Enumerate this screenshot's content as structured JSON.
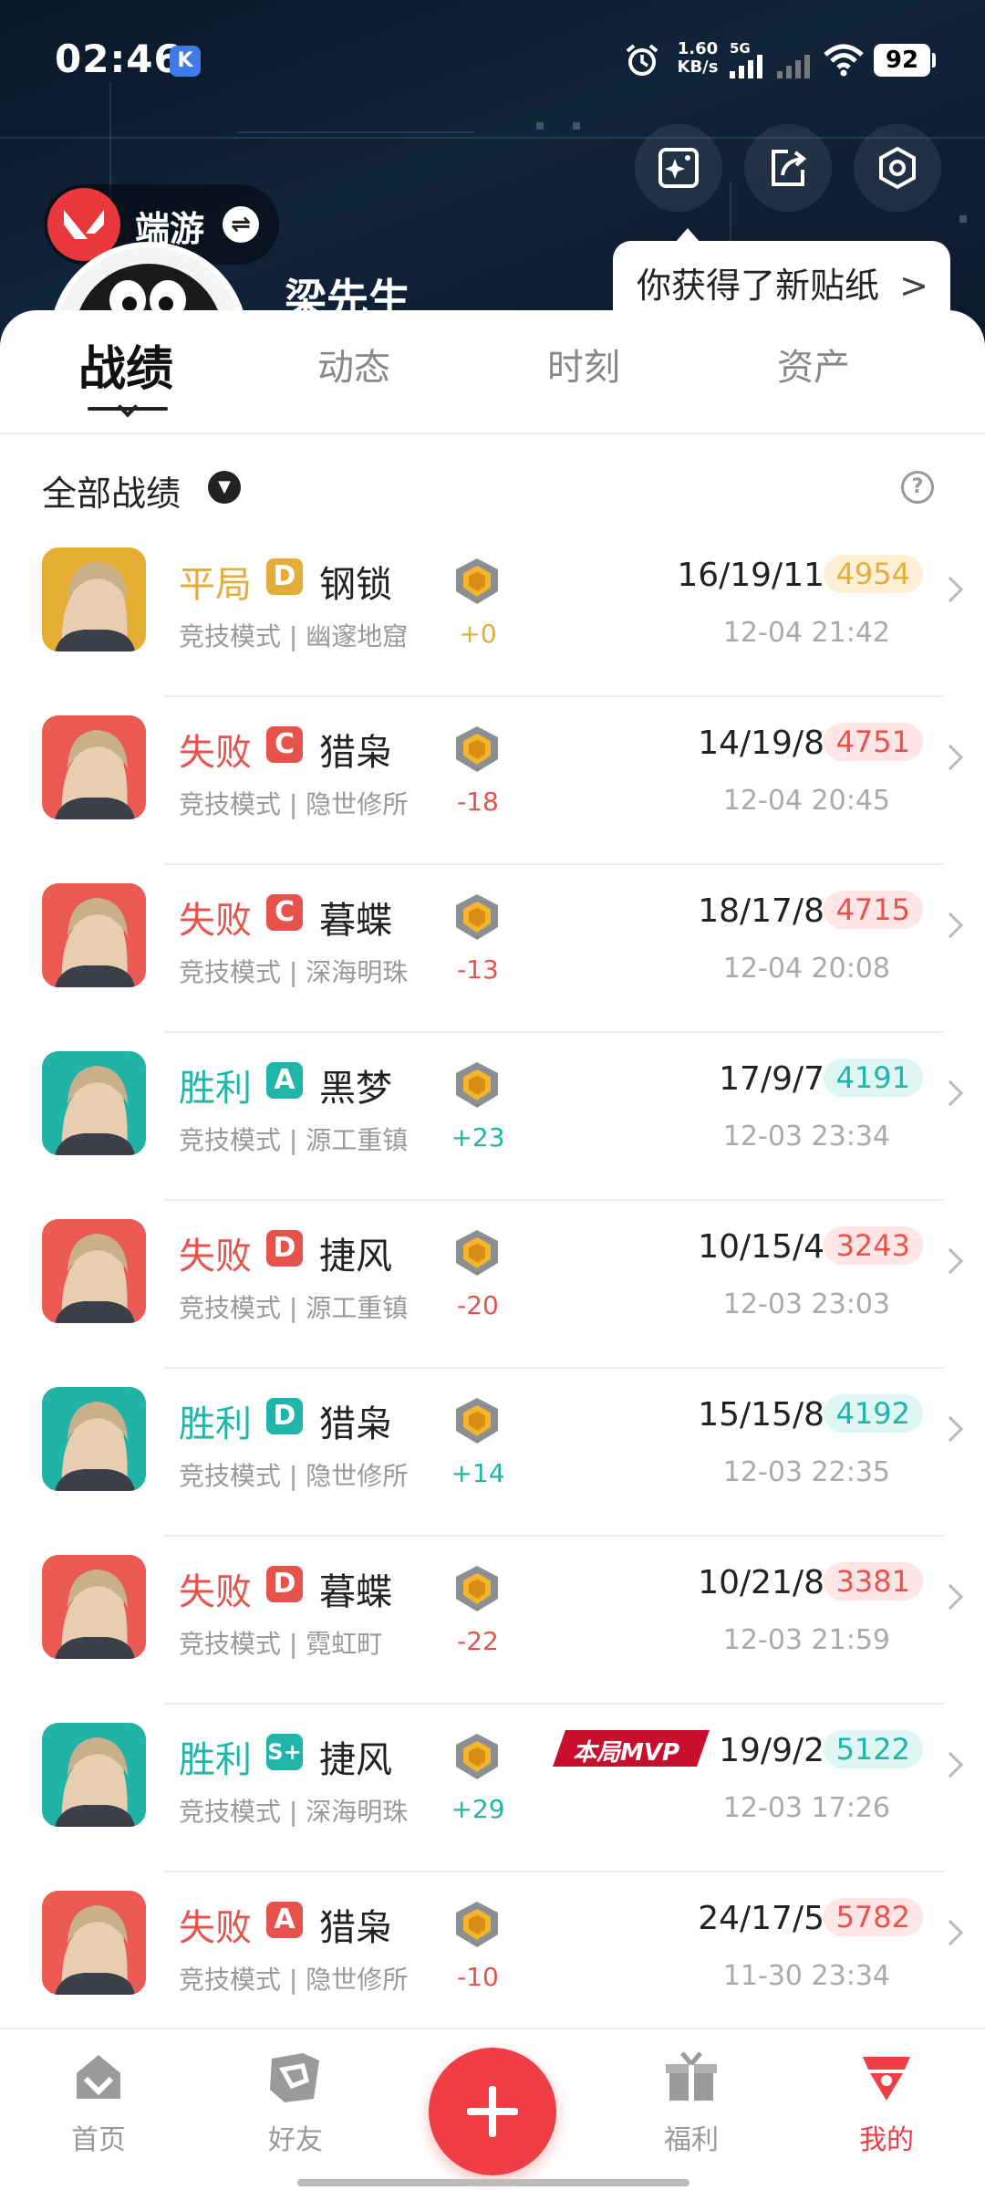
{
  "status_bar": {
    "time": "02:46",
    "net_speed": "1.60",
    "net_speed_unit": "KB/s",
    "network": "5G",
    "battery": "92"
  },
  "profile": {
    "platform": "端游",
    "username": "梁先生",
    "sticker_notice": "你获得了新贴纸",
    "sticker_arrow": ">"
  },
  "tabs": [
    "战绩",
    "动态",
    "时刻",
    "资产"
  ],
  "filter": {
    "label": "全部战绩",
    "help": "?"
  },
  "colors": {
    "win": "#1fb5a9",
    "loss": "#e8524c",
    "draw": "#e4ad3a",
    "accent": "#ef3e46"
  },
  "matches": [
    {
      "result": "平局",
      "grade": "D",
      "agent": "钢锁",
      "mode": "竞技模式",
      "map": "幽邃地窟",
      "delta": "+0",
      "kda": "16/19/11",
      "score": "4954",
      "date": "12-04 21:42",
      "type": "draw",
      "mvp": ""
    },
    {
      "result": "失败",
      "grade": "C",
      "agent": "猎枭",
      "mode": "竞技模式",
      "map": "隐世修所",
      "delta": "-18",
      "kda": "14/19/8",
      "score": "4751",
      "date": "12-04 20:45",
      "type": "loss",
      "mvp": ""
    },
    {
      "result": "失败",
      "grade": "C",
      "agent": "暮蝶",
      "mode": "竞技模式",
      "map": "深海明珠",
      "delta": "-13",
      "kda": "18/17/8",
      "score": "4715",
      "date": "12-04 20:08",
      "type": "loss",
      "mvp": ""
    },
    {
      "result": "胜利",
      "grade": "A",
      "agent": "黑梦",
      "mode": "竞技模式",
      "map": "源工重镇",
      "delta": "+23",
      "kda": "17/9/7",
      "score": "4191",
      "date": "12-03 23:34",
      "type": "win",
      "mvp": ""
    },
    {
      "result": "失败",
      "grade": "D",
      "agent": "捷风",
      "mode": "竞技模式",
      "map": "源工重镇",
      "delta": "-20",
      "kda": "10/15/4",
      "score": "3243",
      "date": "12-03 23:03",
      "type": "loss",
      "mvp": ""
    },
    {
      "result": "胜利",
      "grade": "D",
      "agent": "猎枭",
      "mode": "竞技模式",
      "map": "隐世修所",
      "delta": "+14",
      "kda": "15/15/8",
      "score": "4192",
      "date": "12-03 22:35",
      "type": "win",
      "mvp": ""
    },
    {
      "result": "失败",
      "grade": "D",
      "agent": "暮蝶",
      "mode": "竞技模式",
      "map": "霓虹町",
      "delta": "-22",
      "kda": "10/21/8",
      "score": "3381",
      "date": "12-03 21:59",
      "type": "loss",
      "mvp": ""
    },
    {
      "result": "胜利",
      "grade": "S+",
      "agent": "捷风",
      "mode": "竞技模式",
      "map": "深海明珠",
      "delta": "+29",
      "kda": "19/9/2",
      "score": "5122",
      "date": "12-03 17:26",
      "type": "win",
      "mvp": "本局MVP"
    },
    {
      "result": "失败",
      "grade": "A",
      "agent": "猎枭",
      "mode": "竞技模式",
      "map": "隐世修所",
      "delta": "-10",
      "kda": "24/17/5",
      "score": "5782",
      "date": "11-30 23:34",
      "type": "loss",
      "mvp": ""
    }
  ],
  "nav": {
    "home": "首页",
    "friends": "好友",
    "welfare": "福利",
    "mine": "我的"
  },
  "icons": {
    "header_buttons": [
      "sticker-icon",
      "share-icon",
      "settings-icon"
    ],
    "nav": [
      "home-icon",
      "friends-icon",
      "add-icon",
      "gift-icon",
      "profile-icon"
    ]
  }
}
